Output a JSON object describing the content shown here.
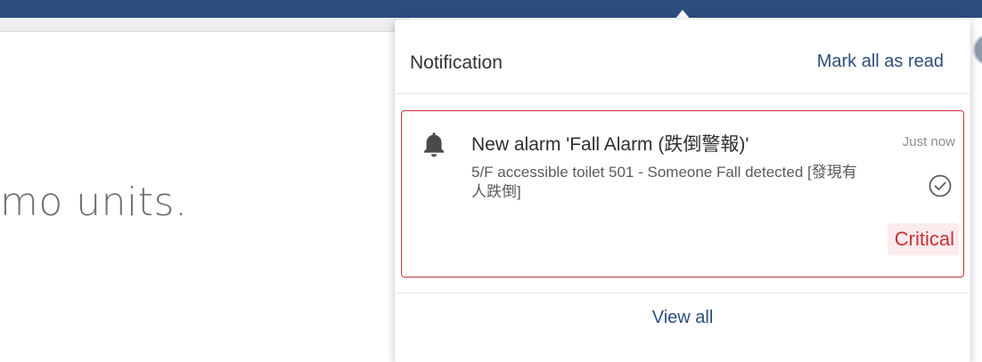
{
  "background": {
    "page_text": "mo units."
  },
  "notification_panel": {
    "title": "Notification",
    "mark_all_label": "Mark all as read",
    "items": [
      {
        "icon": "bell-icon",
        "title": "New alarm 'Fall Alarm (跌倒警報)'",
        "description": "5/F accessible toilet 501 - Someone Fall detected [發現有人跌倒]",
        "time": "Just now",
        "severity": "Critical",
        "action_icon": "check-circle-icon"
      }
    ],
    "view_all_label": "View all"
  },
  "colors": {
    "nav_bar": "#2b4e7e",
    "link": "#2b4e7e",
    "critical": "#c8323a",
    "critical_bg": "#fcebec"
  }
}
